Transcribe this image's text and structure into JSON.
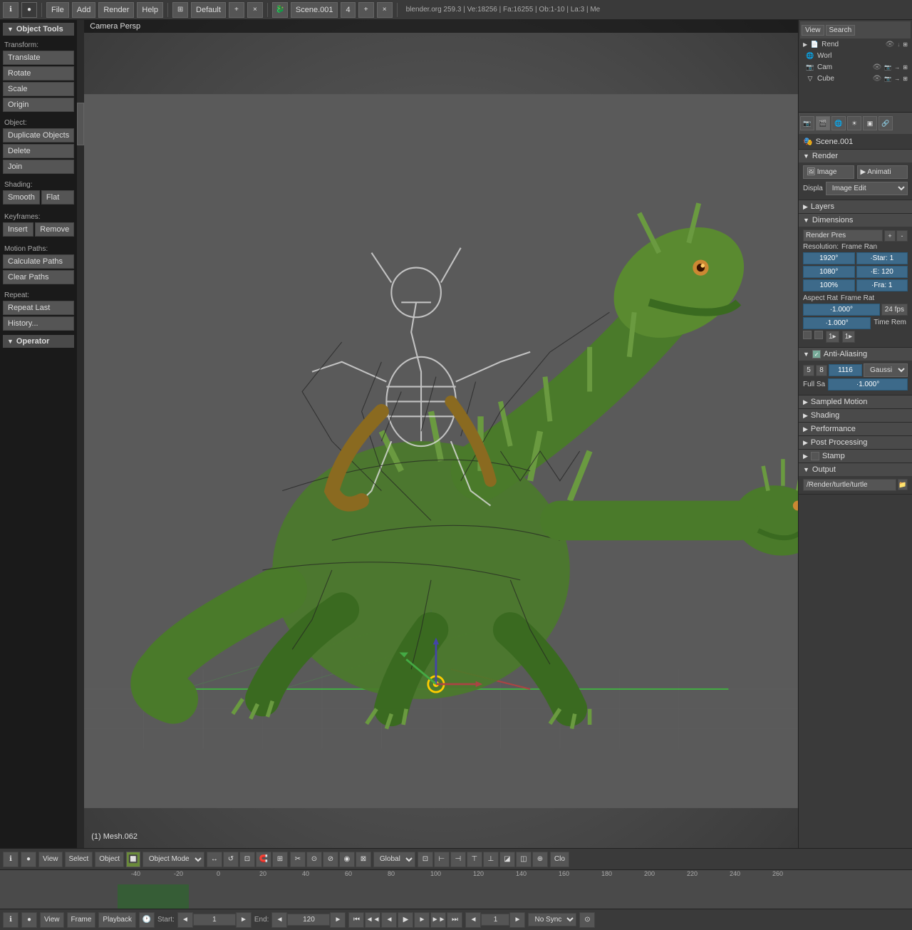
{
  "topbar": {
    "info_icon": "ℹ",
    "menus": [
      "File",
      "Add",
      "Render",
      "Help"
    ],
    "layout": "Default",
    "scene": "Scene.001",
    "scene_num": "4",
    "stats": "blender.org 259.3 | Ve:18256 | Fa:16255 | Ob:1-10 | La:3 | Me",
    "close": "×",
    "plus": "+"
  },
  "outliner": {
    "view_btn": "View",
    "search_btn": "Search",
    "items": [
      {
        "icon": "📷",
        "name": "Rend",
        "eye": true,
        "cam": true
      },
      {
        "icon": "🌐",
        "name": "Worl",
        "eye": true,
        "cam": false
      },
      {
        "icon": "📷",
        "name": "Cam",
        "eye": true,
        "cam": true
      },
      {
        "icon": "▽",
        "name": "Cube",
        "eye": true,
        "cam": true
      }
    ]
  },
  "viewport": {
    "label": "Camera Persp",
    "object_label": "(1) Mesh.062"
  },
  "left_panel": {
    "title": "Object Tools",
    "sections": {
      "transform": {
        "label": "Transform:",
        "buttons": [
          "Translate",
          "Rotate",
          "Scale",
          "Origin"
        ]
      },
      "object": {
        "label": "Object:",
        "buttons": [
          "Duplicate Objects",
          "Delete",
          "Join"
        ]
      },
      "shading": {
        "label": "Shading:",
        "buttons_row": [
          "Smooth",
          "Flat"
        ]
      },
      "keyframes": {
        "label": "Keyframes:",
        "buttons_row": [
          "Insert",
          "Remove"
        ]
      },
      "motion_paths": {
        "label": "Motion Paths:",
        "buttons": [
          "Calculate Paths",
          "Clear Paths"
        ]
      },
      "repeat": {
        "label": "Repeat:",
        "buttons": [
          "Repeat Last",
          "History..."
        ]
      },
      "operator": {
        "label": "Operator"
      }
    }
  },
  "properties": {
    "scene_name": "Scene.001",
    "sections": {
      "render": {
        "label": "Render",
        "image_btn": "Image",
        "anim_btn": "Animati",
        "display_label": "Displa",
        "display_value": "Image Edit"
      },
      "layers": {
        "label": "Layers",
        "collapsed": true
      },
      "dimensions": {
        "label": "Dimensions",
        "preset_label": "Render Pres",
        "resolution_label": "Resolution:",
        "width": "1920°",
        "height": "1080°",
        "percent": "100%",
        "frame_range_label": "Frame Ran",
        "start": "·Star: 1",
        "end": "·E: 120",
        "fra": "·Fra: 1",
        "aspect_label": "Aspect Rat",
        "frame_rate_label": "Frame Rat",
        "aspect_x": "·1.000°",
        "aspect_y": "·1.000°",
        "fps": "24 fps",
        "time_rem_label": "Time Rem"
      },
      "anti_aliasing": {
        "label": "Anti-Aliasing",
        "enabled": true,
        "val1": "5",
        "val2": "8",
        "val3": "1116",
        "filter": "Gaussi",
        "full_sa": "Full Sa",
        "full_sa_val": "·1.000°"
      },
      "sampled_motion": {
        "label": "Sampled Motion",
        "collapsed": true
      },
      "shading": {
        "label": "Shading",
        "collapsed": true
      },
      "performance": {
        "label": "Performance",
        "collapsed": true
      },
      "post_processing": {
        "label": "Post Processing",
        "collapsed": true
      },
      "stamp": {
        "label": "Stamp",
        "collapsed": true
      },
      "output": {
        "label": "Output",
        "path": "/Render/turtle/turtle"
      }
    }
  },
  "bottom_toolbar": {
    "view": "View",
    "select": "Select",
    "object": "Object",
    "mode": "Object Mode",
    "global": "Global",
    "close": "Clo"
  },
  "playback": {
    "view": "View",
    "frame": "Frame",
    "playback": "Playback",
    "start_label": "Start:",
    "start_val": "1",
    "end_label": "End:",
    "end_val": "120",
    "current": "1",
    "sync": "No Sync"
  },
  "timeline": {
    "marks": [
      "-40",
      "-20",
      "0",
      "20",
      "40",
      "60",
      "80",
      "100",
      "120",
      "140",
      "160",
      "180",
      "200",
      "220",
      "240",
      "260"
    ]
  }
}
